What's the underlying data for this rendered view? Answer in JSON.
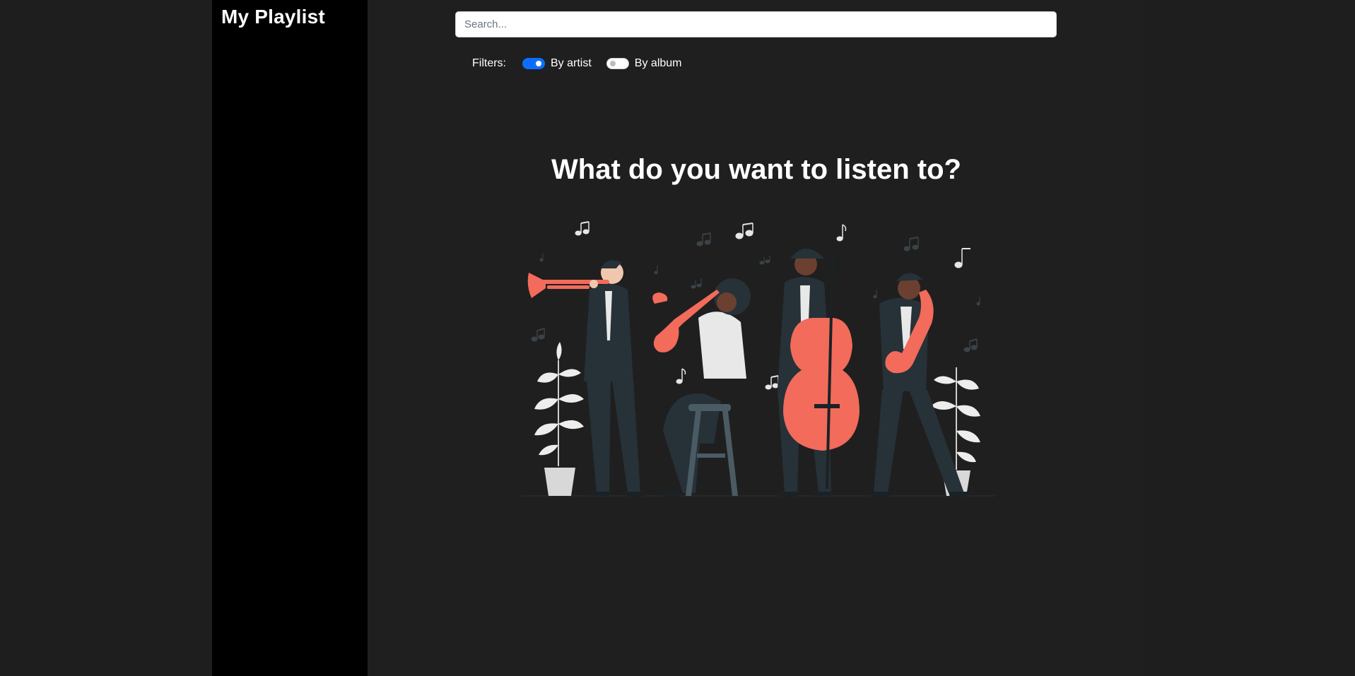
{
  "sidebar": {
    "title": "My Playlist"
  },
  "search": {
    "placeholder": "Search...",
    "value": ""
  },
  "filters": {
    "label": "Filters:",
    "options": [
      {
        "label": "By artist",
        "checked": true
      },
      {
        "label": "By album",
        "checked": false
      }
    ]
  },
  "main": {
    "heading": "What do you want to listen to?"
  },
  "illustration": {
    "icon": "jazz-band-illustration",
    "accent_color": "#f26b5b",
    "suit_color": "#263238",
    "shirt_color": "#e8e8e8"
  },
  "colors": {
    "page_background": "#1e1e1e",
    "sidebar_background": "#000000",
    "toggle_on": "#0d6efd",
    "text": "#ffffff"
  }
}
